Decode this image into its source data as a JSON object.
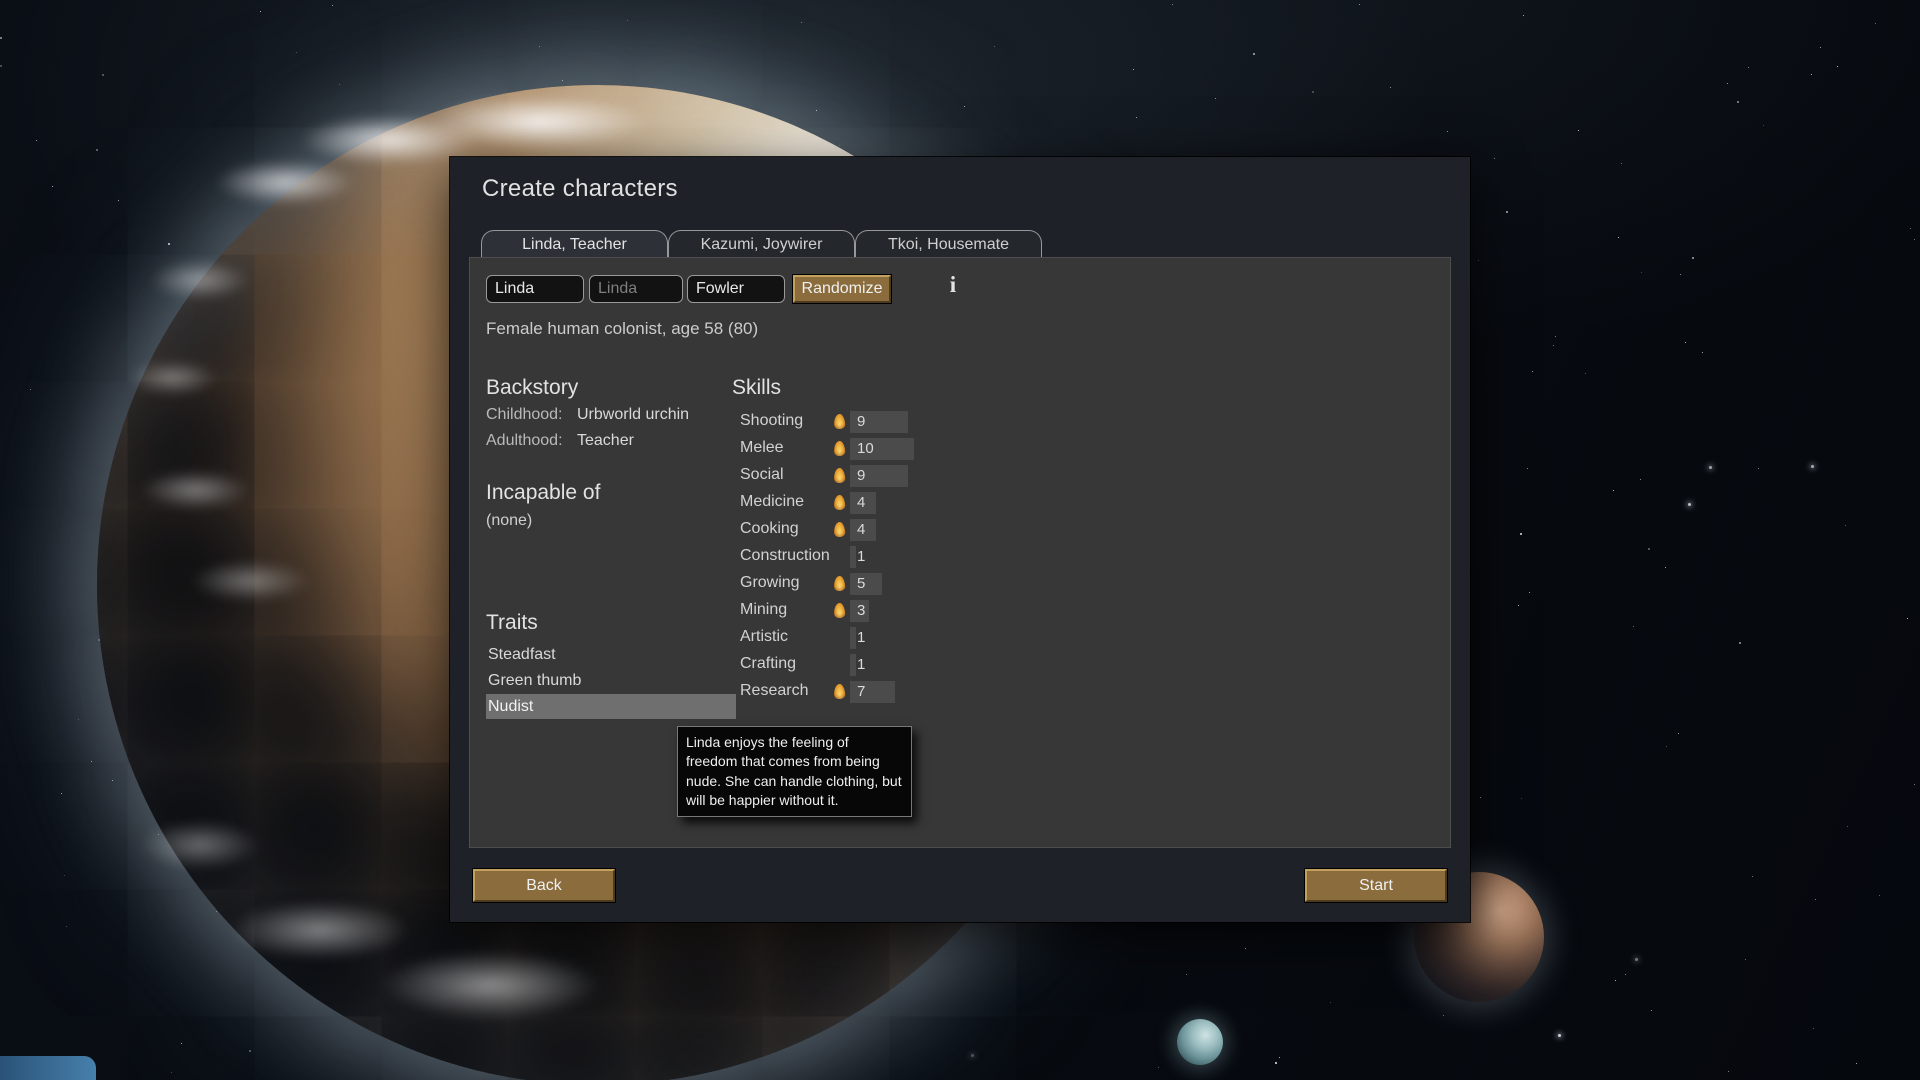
{
  "window": {
    "title": "Create characters"
  },
  "tabs": [
    {
      "label": "Linda, Teacher",
      "active": true
    },
    {
      "label": "Kazumi, Joywirer",
      "active": false
    },
    {
      "label": "Tkoi, Housemate",
      "active": false
    }
  ],
  "name_row": {
    "first_name": "Linda",
    "nick_placeholder": "Linda",
    "last_name": "Fowler",
    "randomize_label": "Randomize",
    "info_icon_glyph": "i"
  },
  "summary": "Female human colonist, age 58 (80)",
  "backstory": {
    "heading": "Backstory",
    "rows": [
      {
        "label": "Childhood:",
        "value": "Urbworld urchin"
      },
      {
        "label": "Adulthood:",
        "value": "Teacher"
      }
    ]
  },
  "incapable": {
    "heading": "Incapable of",
    "value": "(none)"
  },
  "traits": {
    "heading": "Traits",
    "items": [
      "Steadfast",
      "Green thumb",
      "Nudist"
    ],
    "highlighted": "Nudist"
  },
  "skills": {
    "heading": "Skills",
    "max_level": 20,
    "items": [
      {
        "name": "Shooting",
        "level": 9,
        "passion": true
      },
      {
        "name": "Melee",
        "level": 10,
        "passion": true
      },
      {
        "name": "Social",
        "level": 9,
        "passion": true
      },
      {
        "name": "Medicine",
        "level": 4,
        "passion": true
      },
      {
        "name": "Cooking",
        "level": 4,
        "passion": true
      },
      {
        "name": "Construction",
        "level": 1,
        "passion": false
      },
      {
        "name": "Growing",
        "level": 5,
        "passion": true
      },
      {
        "name": "Mining",
        "level": 3,
        "passion": true
      },
      {
        "name": "Artistic",
        "level": 1,
        "passion": false
      },
      {
        "name": "Crafting",
        "level": 1,
        "passion": false
      },
      {
        "name": "Research",
        "level": 7,
        "passion": true
      }
    ]
  },
  "tooltip": {
    "text": "Linda enjoys the feeling of freedom that comes from being nude. She can handle clothing, but will be happier without it."
  },
  "footer": {
    "back_label": "Back",
    "start_label": "Start"
  },
  "colors": {
    "dialog_dark": "#1e2127",
    "panel_gray": "#373737",
    "button_brown": "#8a6c3d",
    "skill_bar_fill": "#4b4b4b",
    "passion_flame": "#f0b43e",
    "trait_highlight": "#6f6f6f",
    "tooltip_bg": "#070707"
  }
}
